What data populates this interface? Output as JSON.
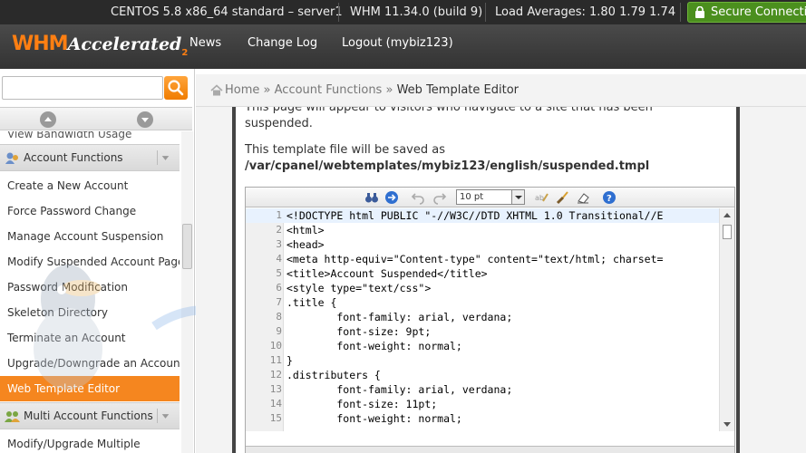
{
  "status_bar": {
    "os": "CENTOS 5.8 x86_64 standard – server1",
    "version": "WHM 11.34.0 (build 9)",
    "load": "Load Averages: 1.80 1.79 1.74",
    "secure": "Secure Connection"
  },
  "header": {
    "logo_whm": "WHM",
    "logo_accelerated": "Accelerated",
    "logo_two": "2",
    "nav": [
      "News",
      "Change Log",
      "Logout (mybiz123)"
    ]
  },
  "sidebar": {
    "search_placeholder": "",
    "cut_item": "View Bandwidth Usage",
    "groups": [
      {
        "label": "Account Functions",
        "items": [
          "Create a New Account",
          "Force Password Change",
          "Manage Account Suspension",
          "Modify Suspended Account Page",
          "Password Modification",
          "Skeleton Directory",
          "Terminate an Account",
          "Upgrade/Downgrade an Account",
          "Web Template Editor"
        ]
      },
      {
        "label": "Multi Account Functions",
        "items": [
          "Modify/Upgrade Multiple"
        ]
      }
    ],
    "active_item": "Web Template Editor"
  },
  "breadcrumb": {
    "home": "Home",
    "sep": "»",
    "section": "Account Functions",
    "current": "Web Template Editor"
  },
  "main": {
    "desc": "This page will appear to visitors who navigate to a site that has been suspended.",
    "save_note": "This template file will be saved as",
    "save_path": "/var/cpanel/webtemplates/mybiz123/english/suspended.tmpl"
  },
  "editor": {
    "font_size": "10 pt",
    "lines": [
      {
        "n": "1",
        "t": "<!DOCTYPE html PUBLIC \"-//W3C//DTD XHTML 1.0 Transitional//E"
      },
      {
        "n": "2",
        "t": "<html>"
      },
      {
        "n": "3",
        "t": "<head>"
      },
      {
        "n": "4",
        "t": "<meta http-equiv=\"Content-type\" content=\"text/html; charset="
      },
      {
        "n": "5",
        "t": "<title>Account Suspended</title>"
      },
      {
        "n": "6",
        "t": "<style type=\"text/css\">"
      },
      {
        "n": "7",
        "t": ".title {"
      },
      {
        "n": "8",
        "t": "        font-family: arial, verdana;"
      },
      {
        "n": "9",
        "t": "        font-size: 9pt;"
      },
      {
        "n": "10",
        "t": "        font-weight: normal;"
      },
      {
        "n": "11",
        "t": "}"
      },
      {
        "n": "12",
        "t": ".distributers {"
      },
      {
        "n": "13",
        "t": "        font-family: arial, verdana;"
      },
      {
        "n": "14",
        "t": "        font-size: 11pt;"
      },
      {
        "n": "15",
        "t": "        font-weight: normal;"
      }
    ]
  },
  "colors": {
    "accent": "#f5861f",
    "topbar": "#2a2a2a",
    "secure_green": "#4b8f1e"
  }
}
